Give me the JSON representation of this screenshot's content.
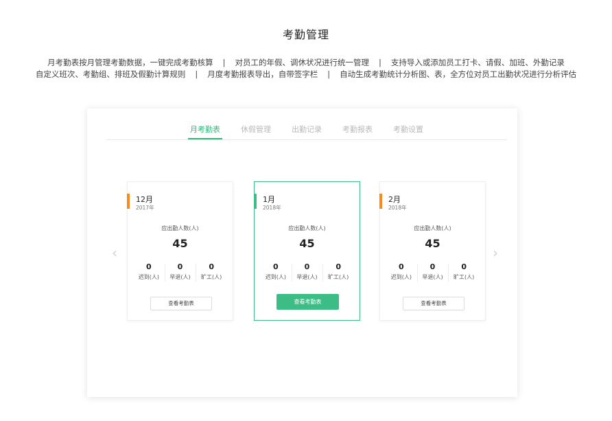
{
  "title": "考勤管理",
  "description": {
    "line1": [
      "月考勤表按月管理考勤数据，一键完成考勤核算",
      "对员工的年假、调休状况进行统一管理",
      "支持导入或添加员工打卡、请假、加班、外勤记录"
    ],
    "line2": [
      "自定义班次、考勤组、排班及假勤计算规则",
      "月度考勤报表导出，自带签字栏",
      "自动生成考勤统计分析图、表，全方位对员工出勤状况进行分析评估"
    ],
    "separator": "|"
  },
  "tabs": [
    "月考勤表",
    "休假管理",
    "出勤记录",
    "考勤报表",
    "考勤设置"
  ],
  "active_tab": "月考勤表",
  "nav": {
    "prev": "‹",
    "next": "›"
  },
  "cards": [
    {
      "month": "12月",
      "year": "2017年",
      "label": "应出勤人数(人)",
      "total": "45",
      "stats": [
        {
          "value": "0",
          "label": "迟到(人)"
        },
        {
          "value": "0",
          "label": "早退(人)"
        },
        {
          "value": "0",
          "label": "旷工(人)"
        }
      ],
      "button": "查看考勤表"
    },
    {
      "month": "1月",
      "year": "2018年",
      "label": "应出勤人数(人)",
      "total": "45",
      "stats": [
        {
          "value": "0",
          "label": "迟到(人)"
        },
        {
          "value": "0",
          "label": "早退(人)"
        },
        {
          "value": "0",
          "label": "旷工(人)"
        }
      ],
      "button": "查看考勤表"
    },
    {
      "month": "2月",
      "year": "2018年",
      "label": "应出勤人数(人)",
      "total": "45",
      "stats": [
        {
          "value": "0",
          "label": "迟到(人)"
        },
        {
          "value": "0",
          "label": "早退(人)"
        },
        {
          "value": "0",
          "label": "旷工(人)"
        }
      ],
      "button": "查看考勤表"
    }
  ],
  "colors": {
    "accent_green": "#3dbd86",
    "accent_orange": "#f58a1f",
    "tab_inactive": "#b9b9b9"
  }
}
